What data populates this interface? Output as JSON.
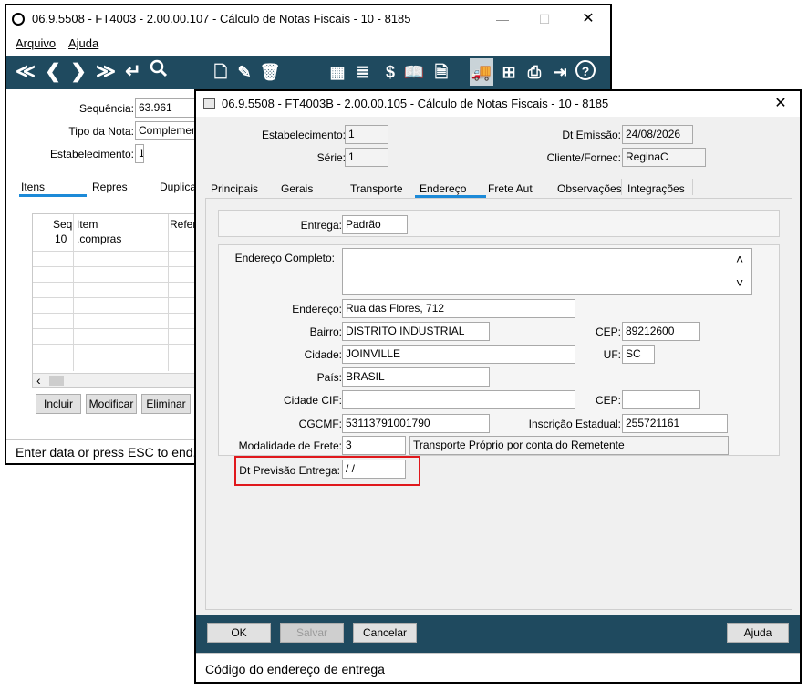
{
  "back_window": {
    "title": "06.9.5508 - FT4003 - 2.00.00.107 - Cálculo de Notas Fiscais - 10 - 8185",
    "controls": {
      "minimize": "—",
      "maximize": "☐",
      "close": "✕"
    },
    "menu": {
      "arquivo": "Arquivo",
      "ajuda": "Ajuda"
    },
    "toolbar_icons": [
      "first-icon",
      "prev-icon",
      "next-icon",
      "last-icon",
      "return-icon",
      "search-icon",
      "new-doc-icon",
      "edit-doc-icon",
      "delete-icon",
      "calculator-icon",
      "report-icon",
      "dollar-icon",
      "book-icon",
      "invoice-icon",
      "truck-icon",
      "tree-icon",
      "print-icon",
      "exit-icon",
      "help-icon"
    ],
    "toolbar_glyphs": {
      "first": "≪",
      "prev": "❮",
      "next": "❯",
      "last": "≫",
      "return": "↵",
      "search": "🔍",
      "new": "🗋",
      "edit": "✎",
      "delete": "🗑",
      "calc": "▦",
      "report": "≣",
      "dollar": "$",
      "book": "📖",
      "invoice": "🗎",
      "truck": "🚚",
      "tree": "⊞",
      "print": "⎙",
      "exit": "⇥",
      "help": "?"
    },
    "fields": {
      "sequencia_label": "Sequência:",
      "sequencia_value": "63.961",
      "tipo_nota_label": "Tipo da Nota:",
      "tipo_nota_value": "Complementa",
      "estabelecimento_label": "Estabelecimento:",
      "estabelecimento_value": "1"
    },
    "tabs": [
      "Itens",
      "Repres",
      "Duplica"
    ],
    "grid": {
      "headers": [
        "Seq",
        "Item",
        "Refer"
      ],
      "rows": [
        {
          "seq": "10",
          "item": ".compras"
        }
      ],
      "scroll_left": "‹"
    },
    "buttons": {
      "incluir": "Incluir",
      "modificar": "Modificar",
      "eliminar": "Eliminar"
    },
    "status": "Enter data or press ESC to end."
  },
  "front_window": {
    "title": "06.9.5508 - FT4003B - 2.00.00.105 - Cálculo de Notas Fiscais - 10 - 8185",
    "close": "✕",
    "header": {
      "estabelecimento_label": "Estabelecimento:",
      "estabelecimento_value": "1",
      "serie_label": "Série:",
      "serie_value": "1",
      "dt_emissao_label": "Dt Emissão:",
      "dt_emissao_value": "24/08/2026",
      "cliente_label": "Cliente/Fornec:",
      "cliente_value": "ReginaC"
    },
    "tabs": [
      "Principais",
      "Gerais",
      "Transporte",
      "Endereço",
      "Frete Aut",
      "Observações",
      "Integrações"
    ],
    "active_tab": "Endereço",
    "form": {
      "entrega_label": "Entrega:",
      "entrega_value": "Padrão",
      "end_completo_label": "Endereço Completo:",
      "end_completo_value": "",
      "scroll_up": "˄",
      "scroll_down": "˅",
      "endereco_label": "Endereço:",
      "endereco_value": "Rua das Flores, 712",
      "bairro_label": "Bairro:",
      "bairro_value": "DISTRITO INDUSTRIAL",
      "cep_label": "CEP:",
      "cep_value": "89212600",
      "cidade_label": "Cidade:",
      "cidade_value": "JOINVILLE",
      "uf_label": "UF:",
      "uf_value": "SC",
      "pais_label": "País:",
      "pais_value": "BRASIL",
      "cidade_cif_label": "Cidade CIF:",
      "cidade_cif_value": "",
      "cep2_label": "CEP:",
      "cep2_value": "",
      "cgcmf_label": "CGCMF:",
      "cgcmf_value": "53113791001790",
      "ie_label": "Inscrição Estadual:",
      "ie_value": "255721161",
      "modalidade_label": "Modalidade de Frete:",
      "modalidade_value": "3",
      "modalidade_desc": "Transporte Próprio por conta do Remetente",
      "dt_previsao_label": "Dt Previsão Entrega:",
      "dt_previsao_value": " / /"
    },
    "buttons": {
      "ok": "OK",
      "salvar": "Salvar",
      "cancelar": "Cancelar",
      "ajuda": "Ajuda"
    },
    "status": "Código do endereço de entrega",
    "colors": {
      "toolbar": "#1f4a5f",
      "tab_underline": "#1c8ad8",
      "highlight": "#e0181c"
    }
  }
}
